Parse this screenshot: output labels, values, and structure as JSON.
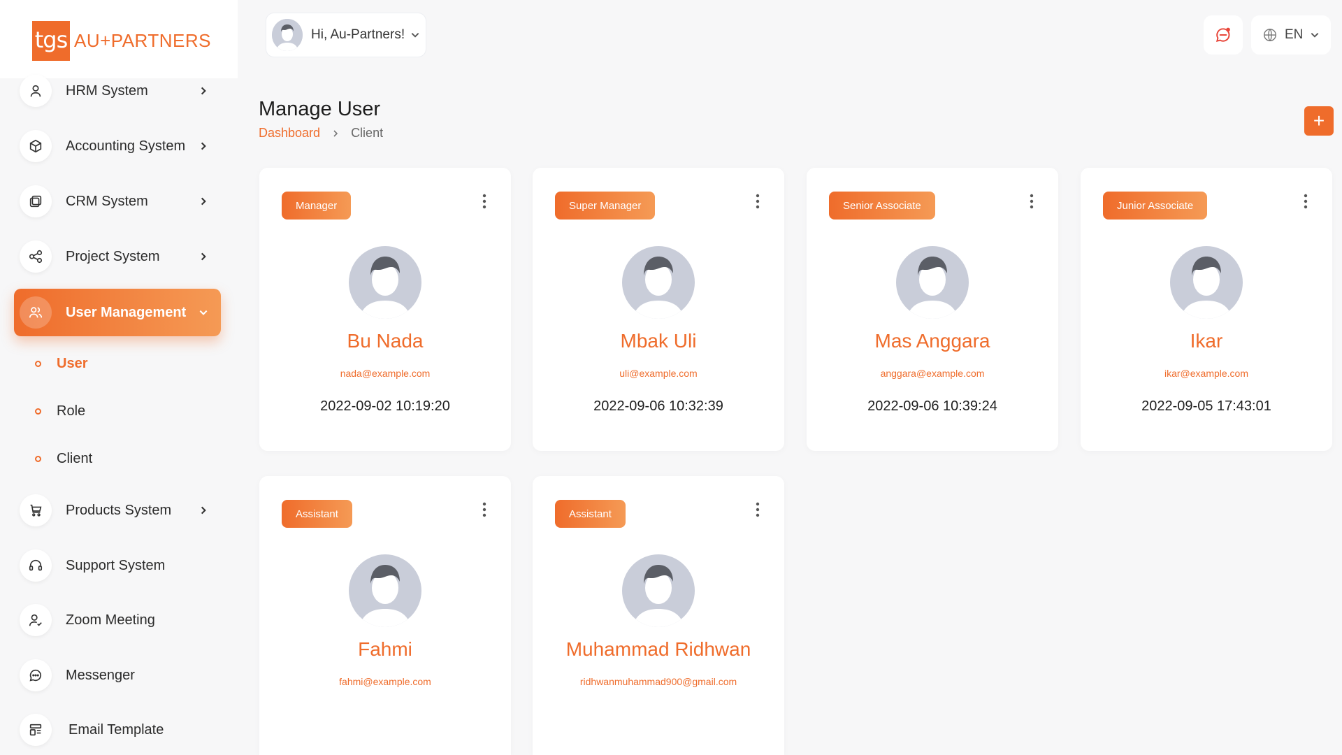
{
  "brand": {
    "logo_mark": "tgs",
    "logo_text": "AU+PARTNERS",
    "accent_color": "#ef6c2b"
  },
  "header": {
    "greeting": "Hi, Au-Partners!",
    "language": "EN",
    "notification_icon": "chat-bell-icon",
    "language_icon": "globe-icon"
  },
  "sidebar": {
    "items": [
      {
        "label": "HRM System",
        "icon": "user-icon"
      },
      {
        "label": "Accounting System",
        "icon": "box-icon"
      },
      {
        "label": "CRM System",
        "icon": "layers-icon"
      },
      {
        "label": "Project System",
        "icon": "share-icon"
      },
      {
        "label": "User Management",
        "icon": "users-icon"
      },
      {
        "label": "Products System",
        "icon": "cart-icon"
      },
      {
        "label": "Support System",
        "icon": "headset-icon"
      },
      {
        "label": "Zoom Meeting",
        "icon": "user-check-icon"
      },
      {
        "label": "Messenger",
        "icon": "message-icon"
      },
      {
        "label": "Email Template",
        "icon": "template-icon"
      }
    ],
    "submenu": [
      {
        "label": "User"
      },
      {
        "label": "Role"
      },
      {
        "label": "Client"
      }
    ]
  },
  "page": {
    "title": "Manage User",
    "breadcrumb": {
      "root": "Dashboard",
      "current": "Client"
    },
    "add_label": "+"
  },
  "users": [
    {
      "role": "Manager",
      "name": "Bu Nada",
      "email": "nada@example.com",
      "date": "2022-09-02 10:19:20"
    },
    {
      "role": "Super Manager",
      "name": "Mbak Uli",
      "email": "uli@example.com",
      "date": "2022-09-06 10:32:39"
    },
    {
      "role": "Senior Associate",
      "name": "Mas Anggara",
      "email": "anggara@example.com",
      "date": "2022-09-06 10:39:24"
    },
    {
      "role": "Junior Associate",
      "name": "Ikar",
      "email": "ikar@example.com",
      "date": "2022-09-05 17:43:01"
    },
    {
      "role": "Assistant",
      "name": "Fahmi",
      "email": "fahmi@example.com",
      "date": ""
    },
    {
      "role": "Assistant",
      "name": "Muhammad Ridhwan",
      "email": "ridhwanmuhammad900@gmail.com",
      "date": ""
    }
  ]
}
